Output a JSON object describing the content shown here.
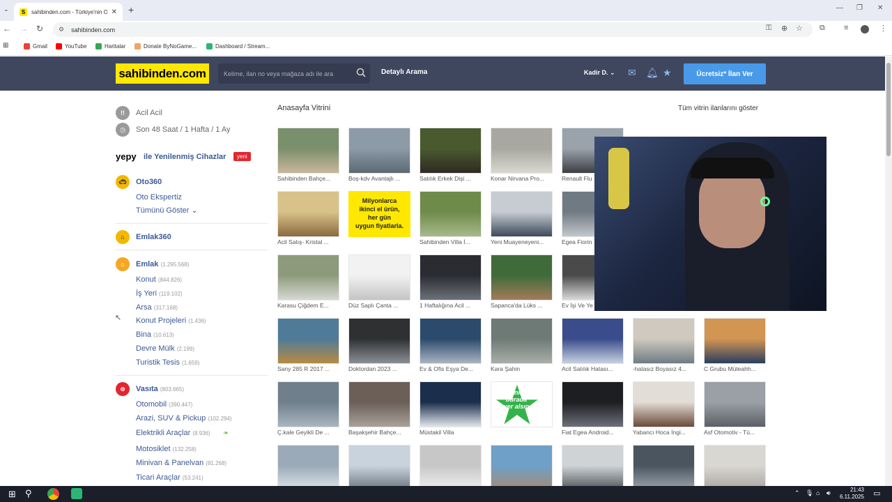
{
  "browser": {
    "tab_title": "sahibinden.com - Türkiye'nin O",
    "tab_favicon": "S",
    "new_tab": "+",
    "tab_close": "✕",
    "url": "sahibinden.com",
    "bookmarks": [
      {
        "label": "Gmail",
        "color": "#ea4335"
      },
      {
        "label": "YouTube",
        "color": "#ff0000"
      },
      {
        "label": "Haritalar",
        "color": "#34a853"
      },
      {
        "label": "Donate ByNoGame...",
        "color": "#f4a261"
      },
      {
        "label": "Dashboard / Stream...",
        "color": "#2bb673"
      }
    ]
  },
  "header": {
    "logo": "sahibinden.com",
    "search_placeholder": "Kelime, ilan no veya mağaza adı ile ara",
    "advanced_search": "Detaylı Arama",
    "user": "Kadir D.",
    "post_ad": "Ücretsiz* İlan Ver"
  },
  "sidebar": {
    "urgent": "Acil Acil",
    "recent": "Son 48 Saat / 1 Hafta / 1 Ay",
    "yepy_logo": "yepy",
    "yepy_label": "ile Yenilenmiş Cihazlar",
    "yepy_badge": "yeni",
    "oto360": "Oto360",
    "oto_ekspertiz": "Oto Ekspertiz",
    "show_all": "Tümünü Göster",
    "emlak360": "Emlak360",
    "emlak": {
      "title": "Emlak",
      "count": "(1.295.568)"
    },
    "emlak_items": [
      {
        "label": "Konut",
        "count": "(844.826)"
      },
      {
        "label": "İş Yeri",
        "count": "(119.102)"
      },
      {
        "label": "Arsa",
        "count": "(317.168)"
      },
      {
        "label": "Konut Projeleri",
        "count": "(1.436)"
      },
      {
        "label": "Bina",
        "count": "(10.613)"
      },
      {
        "label": "Devre Mülk",
        "count": "(2.199)"
      },
      {
        "label": "Turistik Tesis",
        "count": "(1.659)"
      }
    ],
    "vasita": {
      "title": "Vasıta",
      "count": "(803.665)"
    },
    "vasita_items": [
      {
        "label": "Otomobil",
        "count": "(390.447)"
      },
      {
        "label": "Arazi, SUV & Pickup",
        "count": "(102.294)"
      },
      {
        "label": "Elektrikli Araçlar",
        "count": "(8.936)"
      },
      {
        "label": "Motosiklet",
        "count": "(132.258)"
      },
      {
        "label": "Minivan & Panelvan",
        "count": "(81.268)"
      },
      {
        "label": "Ticari Araçlar",
        "count": "(53.241)"
      }
    ]
  },
  "main": {
    "title": "Anasayfa Vitrini",
    "show_all": "Tüm vitrin ilanlarını göster",
    "ad_banner": [
      "Milyonlarca",
      "ikinci el ürün,",
      "her gün",
      "uygun fiyatlarla."
    ],
    "ad_star": [
      "ilanım",
      "burada",
      "yer alsın"
    ],
    "captions": [
      [
        "Sahibinden Bahçe...",
        "Boş-kdv Avantajlı ...",
        "Satılık Erkek Dişi ...",
        "Konar Nirvana Pro...",
        "Renault Flu",
        "",
        ""
      ],
      [
        "Acil Satış- Kristal ...",
        "",
        "Sahibinden Villa İ...",
        "Yeni Muayeneyeni...",
        "Egea Fiorin",
        "",
        ""
      ],
      [
        "Karasu Çiğdem E...",
        "Düz Saplı Çanta ...",
        "1 Haftalığına Acil ...",
        "Sapanca'da Lüks ...",
        "Ev İşi Ve Ye",
        "",
        ""
      ],
      [
        "Sany 285 R 2017 ...",
        "Doktordan 2023 ...",
        "Ev & Ofis Eşya De...",
        "Kara Şahin",
        "Acil Satılık Hatası...",
        "-hatasız Boyasız 4...",
        "C Grubu Müteahh..."
      ],
      [
        "Ç.kale Geyikli De ...",
        "Başakşehir Bahçe...",
        "Müstakil Villa",
        "",
        "Fiat Egea Android...",
        "Yabancı Hoca İngi...",
        "Asf Otomotiv - Tü..."
      ],
      [
        "",
        "",
        "",
        "",
        "",
        "",
        ""
      ]
    ]
  },
  "taskbar": {
    "time": "21:43",
    "date": "6.11.2025"
  }
}
